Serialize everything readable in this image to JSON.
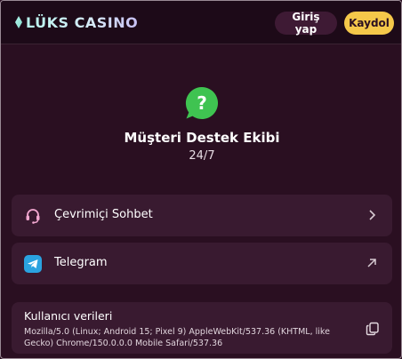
{
  "header": {
    "logo_text": "LÜKS CASINO",
    "login_label": "Giriş yap",
    "register_label": "Kaydol"
  },
  "support": {
    "icon": "whatsapp-question-icon",
    "title": "Müşteri Destek Ekibi",
    "hours": "24/7"
  },
  "channels": [
    {
      "label": "Çevrimiçi Sohbet",
      "icon": "headset-icon",
      "arrow": "chevron-right-icon"
    },
    {
      "label": "Telegram",
      "icon": "telegram-icon",
      "arrow": "arrow-up-right-icon"
    }
  ],
  "user_data": {
    "title": "Kullanıcı verileri",
    "user_agent": "Mozilla/5.0 (Linux; Android 15; Pixel 9) AppleWebKit/537.36 (KHTML, like Gecko) Chrome/150.0.0.0 Mobile Safari/537.36",
    "copy_icon": "copy-icon"
  },
  "colors": {
    "background": "#2a0f21",
    "header": "#1d0a18",
    "card": "#391a30",
    "accent_yellow": "#f5c84a",
    "whatsapp_green": "#3fc351",
    "telegram_blue": "#2aa3e0",
    "headset_pink": "#f2a7d0"
  }
}
